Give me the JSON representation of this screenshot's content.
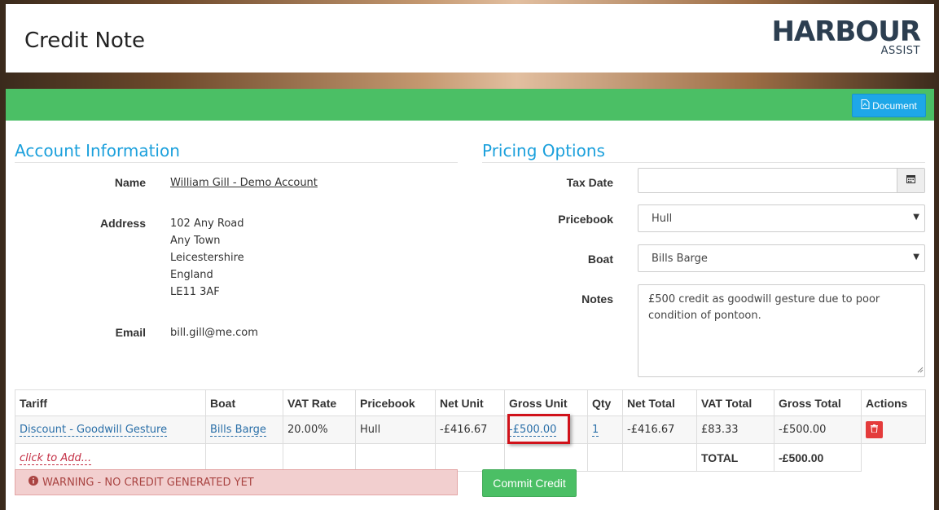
{
  "header": {
    "title": "Credit Note",
    "logo_main": "HARBOUR",
    "logo_sub": "ASSIST"
  },
  "toolbar": {
    "document_label": "Document",
    "document_icon": "pdf-file-icon"
  },
  "account": {
    "section_title": "Account Information",
    "name_label": "Name",
    "name_value": "William Gill - Demo Account",
    "address_label": "Address",
    "address_lines": [
      "102 Any Road",
      "Any Town",
      "Leicestershire",
      "England",
      "LE11 3AF"
    ],
    "email_label": "Email",
    "email_value": "bill.gill@me.com"
  },
  "pricing": {
    "section_title": "Pricing Options",
    "tax_date_label": "Tax Date",
    "tax_date_value": "",
    "pricebook_label": "Pricebook",
    "pricebook_value": "Hull",
    "boat_label": "Boat",
    "boat_value": "Bills Barge",
    "notes_label": "Notes",
    "notes_value": "£500 credit as goodwill gesture due to poor condition of pontoon."
  },
  "table": {
    "headers": [
      "Tariff",
      "Boat",
      "VAT Rate",
      "Pricebook",
      "Net Unit",
      "Gross Unit",
      "Qty",
      "Net Total",
      "VAT Total",
      "Gross Total",
      "Actions"
    ],
    "rows": [
      {
        "tariff": "Discount - Goodwill Gesture",
        "boat": "Bills Barge",
        "vat_rate": "20.00%",
        "pricebook": "Hull",
        "net_unit": "-£416.67",
        "gross_unit": "-£500.00",
        "qty": "1",
        "net_total": "-£416.67",
        "vat_total": "£83.33",
        "gross_total": "-£500.00"
      }
    ],
    "add_label": "click to Add...",
    "total_label": "TOTAL",
    "total_value": "-£500.00"
  },
  "footer": {
    "warning_text": "WARNING - NO CREDIT GENERATED YET",
    "warning_icon": "info-circle-icon",
    "commit_label": "Commit Credit"
  },
  "colors": {
    "accent_green": "#4bbf65",
    "link_blue": "#1ba0dc",
    "danger": "#e43b3b"
  }
}
